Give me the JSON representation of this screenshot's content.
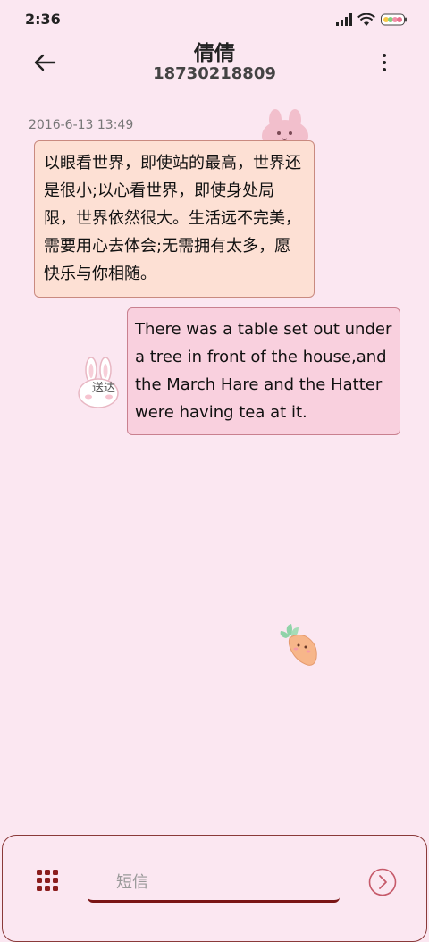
{
  "status_bar": {
    "time": "2:36"
  },
  "header": {
    "contact_name": "倩倩",
    "contact_number": "18730218809",
    "back_icon": "arrow-left-icon",
    "more_icon": "more-vertical-icon"
  },
  "conversation": {
    "timestamp": "2016-6-13 13:49",
    "incoming_message": "以眼看世界，即使站的最高，世界还是很小;以心看世界，即使身处局限，世界依然很大。生活远不完美，需要用心去体会;无需拥有太多，愿快乐与你相随。",
    "outgoing_message": "There was a table set out under a tree in front of the house,and the March Hare and the Hatter were having tea at it.",
    "delivery_status": "送达"
  },
  "composer": {
    "placeholder": "短信",
    "value": "",
    "apps_icon": "grid-icon",
    "send_icon": "send-arrow-icon"
  },
  "colors": {
    "background": "#fbe7f1",
    "incoming_bubble": "#fde0d4",
    "outgoing_bubble": "#f9d0de",
    "accent": "#8b1e1e"
  }
}
